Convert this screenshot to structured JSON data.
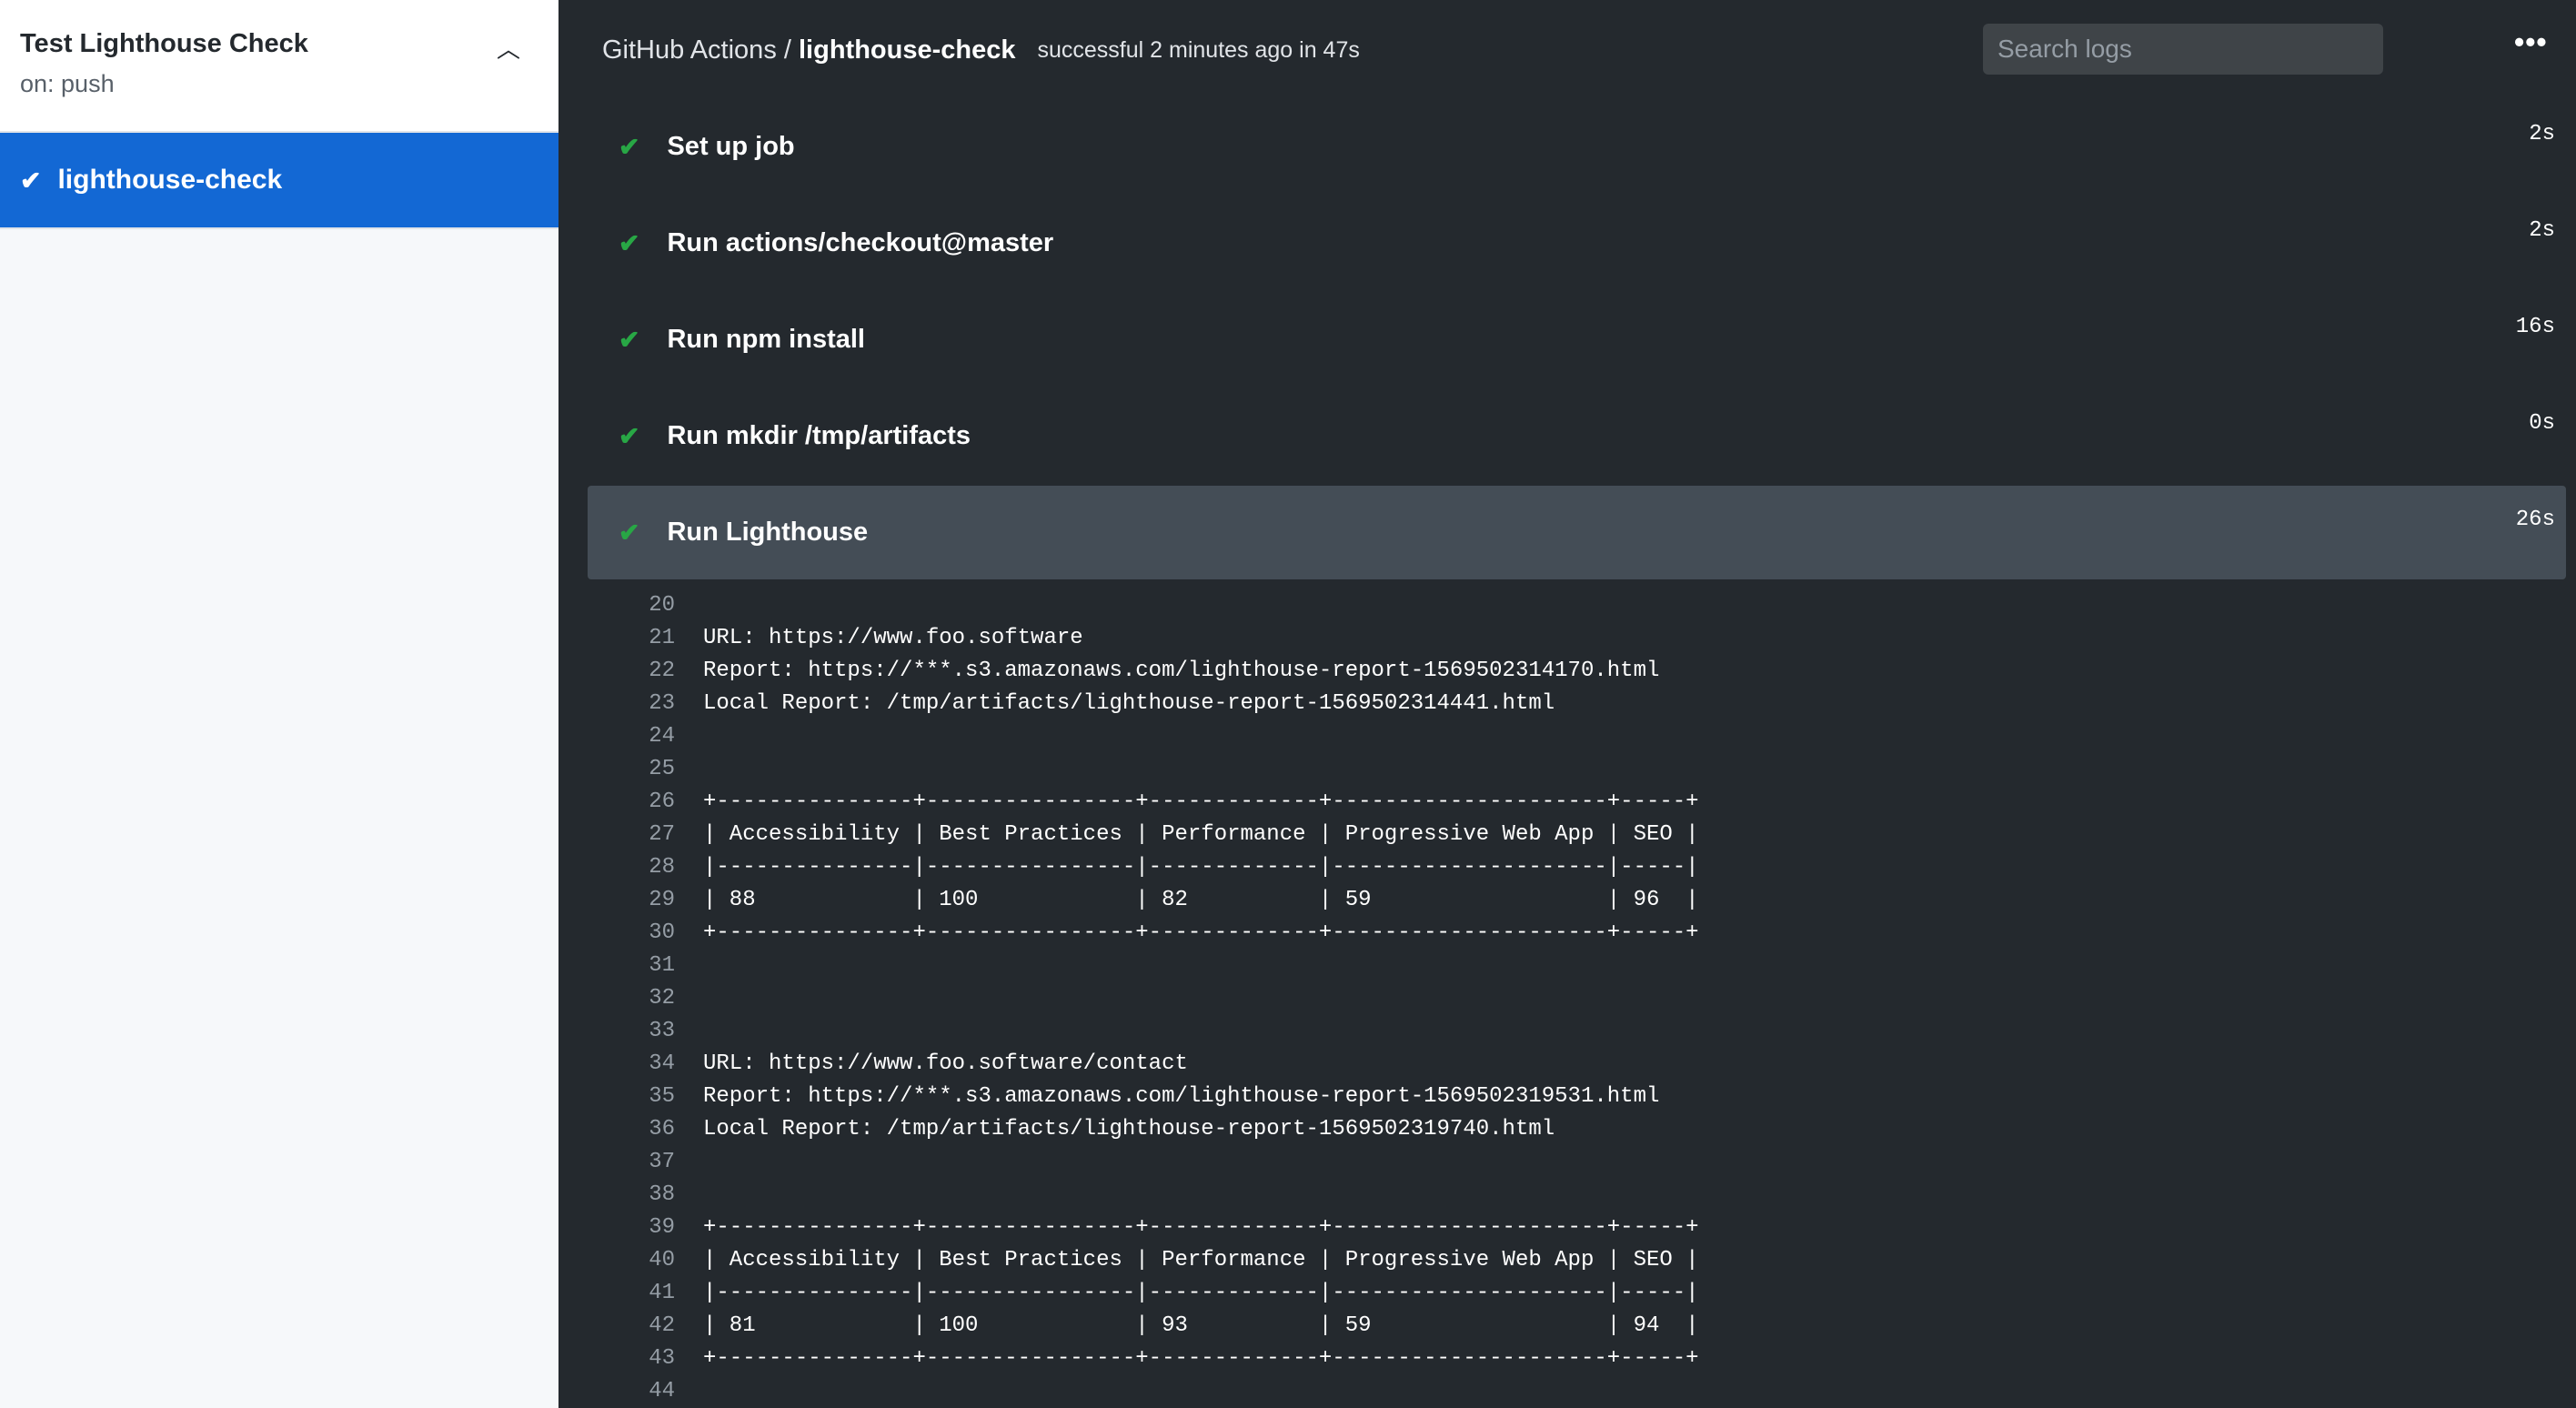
{
  "sidebar": {
    "workflow_title": "Test Lighthouse Check",
    "trigger": "on: push",
    "job": "lighthouse-check"
  },
  "header": {
    "org": "GitHub Actions",
    "sep": " / ",
    "job": "lighthouse-check",
    "status": "successful 2 minutes ago in 47s",
    "search_placeholder": "Search logs",
    "prev": "‹",
    "next": "›",
    "more": "•••"
  },
  "steps": [
    {
      "label": "Set up job",
      "duration": "2s"
    },
    {
      "label": "Run actions/checkout@master",
      "duration": "2s"
    },
    {
      "label": "Run npm install",
      "duration": "16s"
    },
    {
      "label": "Run mkdir /tmp/artifacts",
      "duration": "0s"
    },
    {
      "label": "Run Lighthouse",
      "duration": "26s"
    }
  ],
  "log": [
    {
      "n": "20",
      "t": ""
    },
    {
      "n": "21",
      "t": "URL: https://www.foo.software"
    },
    {
      "n": "22",
      "t": "Report: https://***.s3.amazonaws.com/lighthouse-report-1569502314170.html"
    },
    {
      "n": "23",
      "t": "Local Report: /tmp/artifacts/lighthouse-report-1569502314441.html"
    },
    {
      "n": "24",
      "t": ""
    },
    {
      "n": "25",
      "t": ""
    },
    {
      "n": "26",
      "t": "+---------------+----------------+-------------+---------------------+-----+"
    },
    {
      "n": "27",
      "t": "| Accessibility | Best Practices | Performance | Progressive Web App | SEO |"
    },
    {
      "n": "28",
      "t": "|---------------|----------------|-------------|---------------------|-----|"
    },
    {
      "n": "29",
      "t": "| 88            | 100            | 82          | 59                  | 96  |"
    },
    {
      "n": "30",
      "t": "+---------------+----------------+-------------+---------------------+-----+"
    },
    {
      "n": "31",
      "t": ""
    },
    {
      "n": "32",
      "t": ""
    },
    {
      "n": "33",
      "t": ""
    },
    {
      "n": "34",
      "t": "URL: https://www.foo.software/contact"
    },
    {
      "n": "35",
      "t": "Report: https://***.s3.amazonaws.com/lighthouse-report-1569502319531.html"
    },
    {
      "n": "36",
      "t": "Local Report: /tmp/artifacts/lighthouse-report-1569502319740.html"
    },
    {
      "n": "37",
      "t": ""
    },
    {
      "n": "38",
      "t": ""
    },
    {
      "n": "39",
      "t": "+---------------+----------------+-------------+---------------------+-----+"
    },
    {
      "n": "40",
      "t": "| Accessibility | Best Practices | Performance | Progressive Web App | SEO |"
    },
    {
      "n": "41",
      "t": "|---------------|----------------|-------------|---------------------|-----|"
    },
    {
      "n": "42",
      "t": "| 81            | 100            | 93          | 59                  | 94  |"
    },
    {
      "n": "43",
      "t": "+---------------+----------------+-------------+---------------------+-----+"
    },
    {
      "n": "44",
      "t": ""
    }
  ]
}
